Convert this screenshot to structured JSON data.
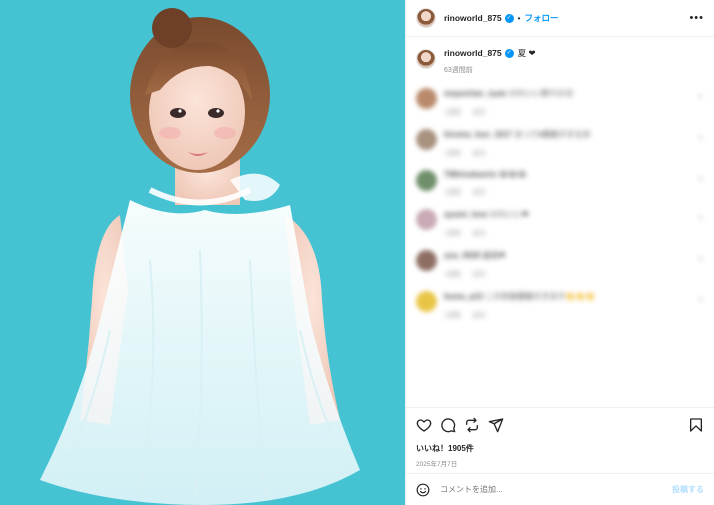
{
  "header": {
    "username": "rinoworld_875",
    "follow_label": "フォロー",
    "more_label": "•••"
  },
  "caption": {
    "username": "rinoworld_875",
    "text": "夏 ❤",
    "time": "63週間前"
  },
  "comments": [
    {
      "user": "mayuchan_nyan",
      "text": "かわいい爽やか",
      "emoji": "😊",
      "time": "1週間",
      "reply": "返信",
      "avatar_color": "#b98a6b"
    },
    {
      "user": "hiromu_kun_1017",
      "text": "まって♥素敵すぎる",
      "emoji": "😍",
      "time": "1週間",
      "reply": "返信",
      "avatar_color": "#a8917e"
    },
    {
      "user": "708rinokaorin",
      "text": "😂😂😂",
      "emoji": "",
      "time": "1週間",
      "reply": "返信",
      "avatar_color": "#6f8f6a"
    },
    {
      "user": "ayumi_love",
      "text": "かわいい",
      "emoji": "❤",
      "time": "1週間",
      "reply": "返信",
      "avatar_color": "#c9a9b5"
    },
    {
      "user": "yuu_0520",
      "text": "最高",
      "emoji": "❤",
      "time": "1週間",
      "reply": "返信",
      "avatar_color": "#8e6e63"
    },
    {
      "user": "kuma_p13",
      "text": "この衣装素敵すぎます",
      "emoji": "👏👏👏",
      "time": "1週間",
      "reply": "返信",
      "avatar_color": "#e9c546"
    }
  ],
  "actions": {
    "likes_text": "いいね！1905件",
    "date_text": "2025年7月7日"
  },
  "add_comment": {
    "placeholder": "コメントを追加...",
    "post_label": "投稿する"
  },
  "colors": {
    "background_photo": "#45c3d3",
    "accent": "#0095f6",
    "post_disabled": "#b2dffc"
  },
  "icons": [
    "like-icon",
    "comment-icon",
    "repost-icon",
    "share-icon",
    "save-icon",
    "emoji-icon",
    "verified-icon",
    "more-icon"
  ]
}
